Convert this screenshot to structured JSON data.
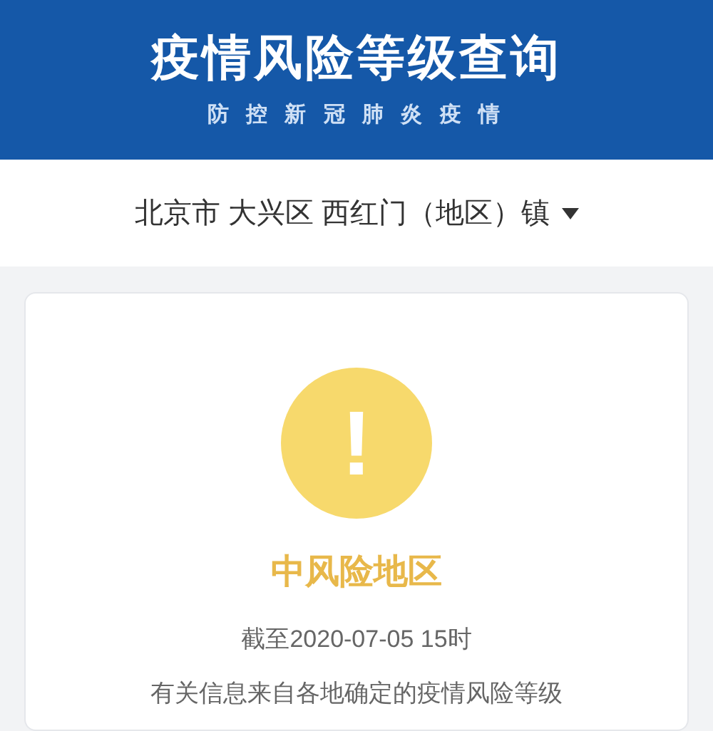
{
  "header": {
    "title": "疫情风险等级查询",
    "subtitle": "防 控 新 冠 肺 炎 疫 情"
  },
  "location": {
    "text": "北京市 大兴区 西红门（地区）镇"
  },
  "result": {
    "kind": "medium",
    "symbol": "!",
    "level_label": "中风险地区",
    "updated": "截至2020-07-05 15时",
    "source": "有关信息来自各地确定的疫情风险等级"
  }
}
